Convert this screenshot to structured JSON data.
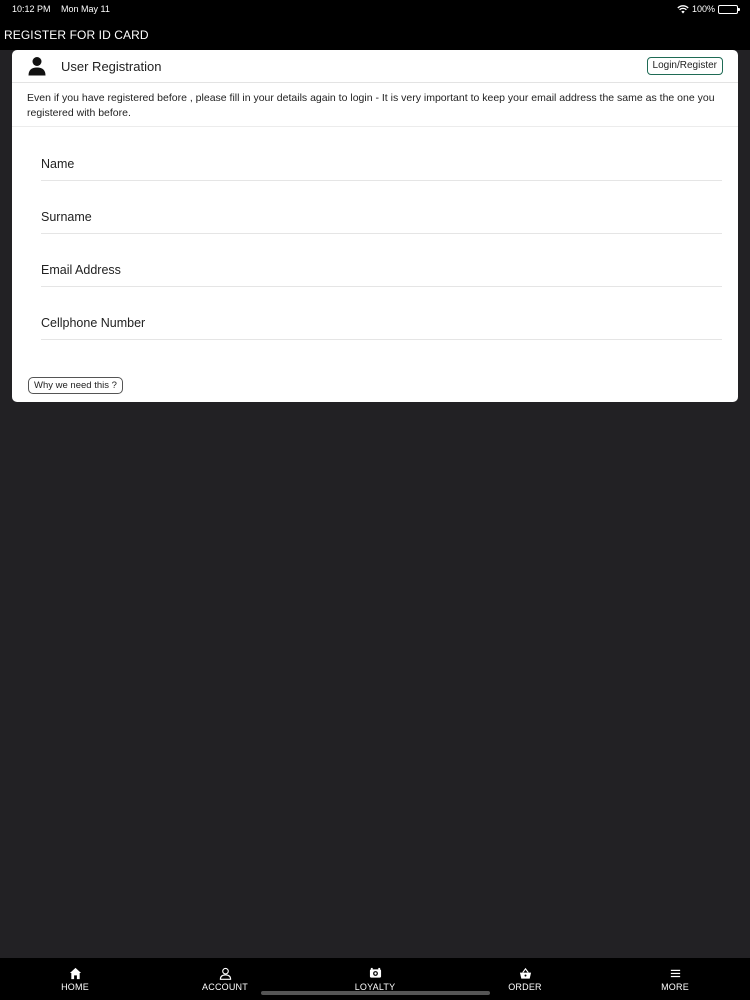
{
  "status_bar": {
    "time": "10:12 PM",
    "date": "Mon May 11",
    "battery": "100%",
    "icons": [
      "wifi-icon",
      "battery-icon"
    ]
  },
  "nav": {
    "title": "REGISTER FOR ID CARD"
  },
  "card": {
    "icon": "person-icon",
    "title": "User Registration",
    "login_button": "Login/Register",
    "notice": "Even if you have registered before , please fill in your details again to login - It is very important to keep your email address the same as the one you registered with before.",
    "fields": {
      "name": {
        "placeholder": "Name",
        "value": ""
      },
      "surname": {
        "placeholder": "Surname",
        "value": ""
      },
      "email": {
        "placeholder": "Email Address",
        "value": ""
      },
      "cellphone": {
        "placeholder": "Cellphone Number",
        "value": ""
      }
    },
    "why_button": "Why we need this ?"
  },
  "tab_bar": {
    "items": [
      {
        "label": "HOME",
        "icon": "home-icon"
      },
      {
        "label": "ACCOUNT",
        "icon": "account-icon"
      },
      {
        "label": "LOYALTY",
        "icon": "loyalty-icon"
      },
      {
        "label": "ORDER",
        "icon": "basket-icon"
      },
      {
        "label": "MORE",
        "icon": "menu-icon"
      }
    ]
  },
  "colors": {
    "background": "#222124",
    "bar": "#000000",
    "card": "#ffffff",
    "accent_border": "#1f6b55"
  }
}
